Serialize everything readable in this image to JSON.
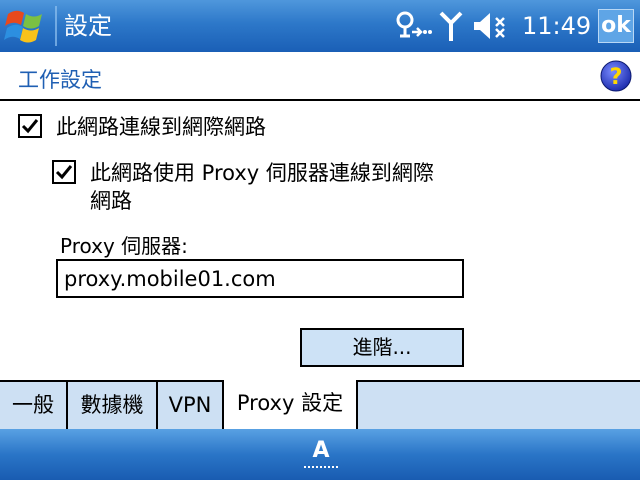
{
  "window": {
    "title": "設定"
  },
  "status_bar": {
    "time": "11:49",
    "ok_label": "ok",
    "icons": [
      "connectivity-icon",
      "signal-icon",
      "volume-muted-icon"
    ]
  },
  "page": {
    "title": "工作設定"
  },
  "options": {
    "connect_internet": {
      "checked": true,
      "label": "此網路連線到網際網路"
    },
    "use_proxy": {
      "checked": true,
      "label_line1": "此網路使用 Proxy 伺服器連線到網際",
      "label_line2": "網路"
    }
  },
  "proxy": {
    "label": "Proxy 伺服器:",
    "value": "proxy.mobile01.com"
  },
  "advanced_button": "進階...",
  "tabs": [
    {
      "label": "一般",
      "active": false
    },
    {
      "label": "數據機",
      "active": false
    },
    {
      "label": "VPN",
      "active": false
    },
    {
      "label": "Proxy 設定",
      "active": true
    }
  ],
  "bottom_bar": {
    "input_indicator": "A"
  },
  "colors": {
    "title_blue": "#2d78c9",
    "header_text": "#1f5fb3",
    "tab_bg": "#cde0f3"
  }
}
